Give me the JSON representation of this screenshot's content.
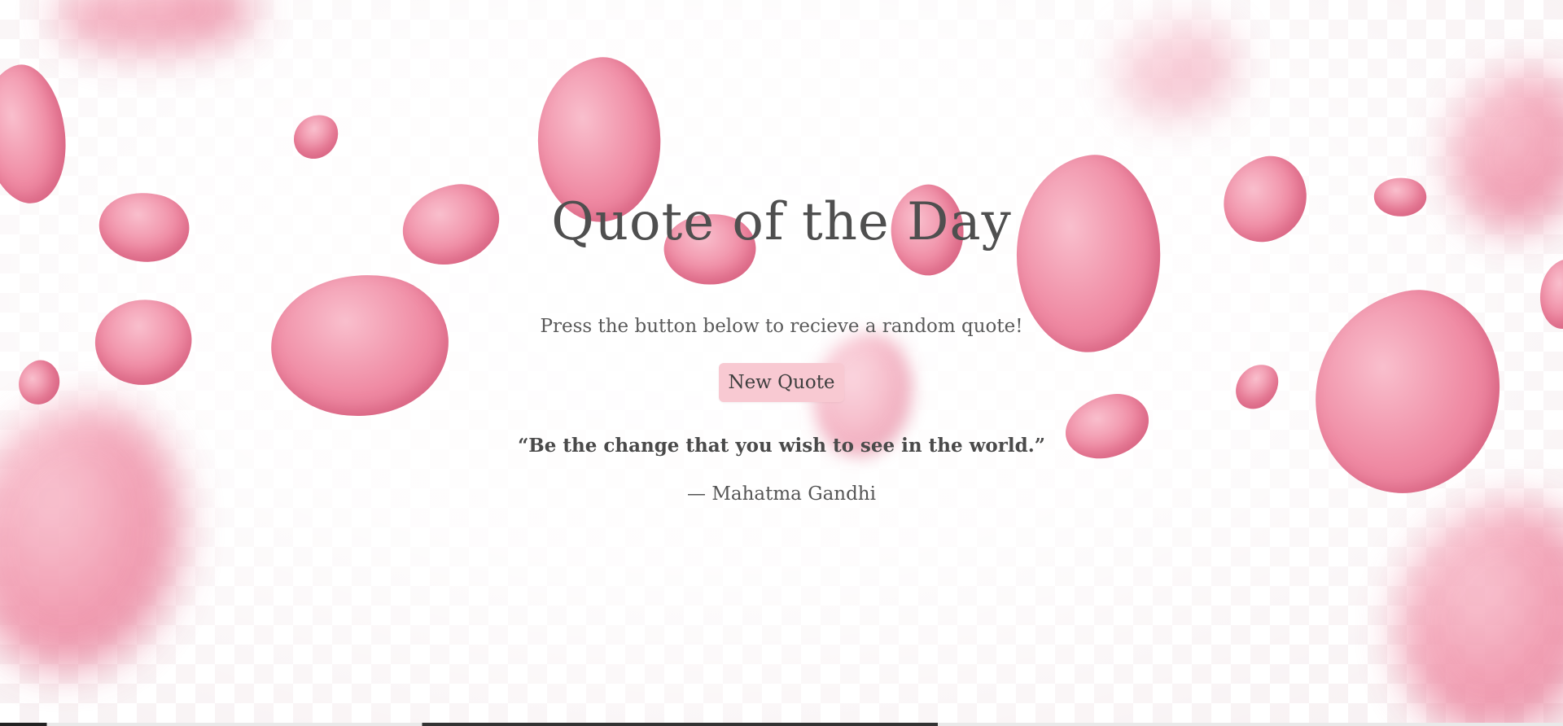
{
  "page": {
    "title": "Quote of the Day",
    "instructions": "Press the button below to recieve a random quote!",
    "button_label": "New Quote"
  },
  "quote": {
    "text": "“Be the change that you wish to see in the world.”",
    "author": "— Mahatma Gandhi"
  },
  "colors": {
    "accent": "#f8c9d2",
    "petal": "#ef8aa3",
    "text": "#555555"
  }
}
